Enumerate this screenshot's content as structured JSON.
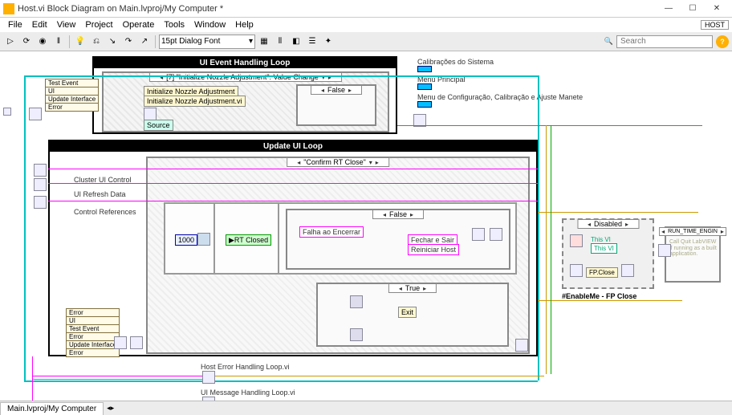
{
  "window": {
    "title": "Host.vi Block Diagram on Main.lvproj/My Computer *",
    "minimize": "—",
    "maximize": "☐",
    "close": "✕"
  },
  "menu": {
    "items": [
      "File",
      "Edit",
      "View",
      "Project",
      "Operate",
      "Tools",
      "Window",
      "Help"
    ],
    "right_label": "HOST"
  },
  "toolbar": {
    "font": "15pt Dialog Font",
    "search_placeholder": "Search"
  },
  "loops": {
    "ui_event": {
      "title": "UI Event Handling Loop",
      "event_case": "[7] \"Initialize Nozzle  Adjustment\": Value Change",
      "items": [
        "Initialize Nozzle  Adjustment",
        "Initialize Nozzle Adjustment.vi"
      ],
      "source": "Source",
      "bundle": [
        "Test Event",
        "UI",
        "Update Interface",
        "Error"
      ],
      "case_val": "False"
    },
    "update_ui": {
      "title": "Update UI Loop",
      "case_label": "\"Confirm RT Close\"",
      "side_labels": [
        "Cluster UI Control",
        "UI Refresh Data",
        "Control References"
      ],
      "inner_case_false": "False",
      "inner_case_true": "True",
      "constant": "1000",
      "rt_closed": "RT Closed",
      "fail_msg": "Falha ao Encerrar",
      "fechar": "Fechar e Sair",
      "reiniciar": "Reiniciar Host",
      "exit": "Exit",
      "bundle": [
        "Error",
        "UI",
        "Test Event",
        "Error",
        "Update Interface",
        "Error"
      ]
    }
  },
  "right_panel": {
    "items": [
      "Calibrações do Sistema",
      "Menu Principal",
      "Menu de Configuração, Calibração e Ajuste Manete"
    ]
  },
  "disabled": {
    "label": "Disabled",
    "this_vi": "This VI",
    "this_vi2": "This VI",
    "fp_close": "FP.Close",
    "run_time": "RUN_TIME_ENGIN",
    "note": "Call Quit LabVIEW if running as a built application.",
    "enable": "#EnableMe - FP Close"
  },
  "bottom_links": {
    "error_loop": "Host Error Handling Loop.vi",
    "msg_loop": "UI Message Handling Loop.vi"
  },
  "tab": {
    "label": "Main.lvproj/My Computer"
  }
}
